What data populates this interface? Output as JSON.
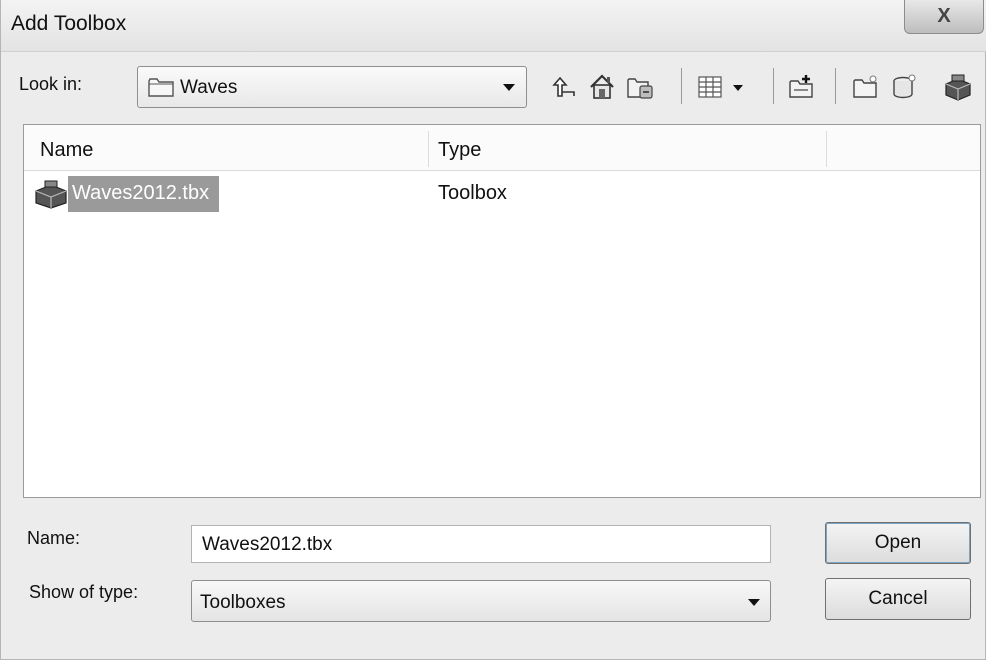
{
  "window": {
    "title": "Add Toolbox",
    "close_glyph": "X"
  },
  "lookin": {
    "label": "Look in:",
    "value": "Waves",
    "icon": "folder-icon"
  },
  "toolbar": {
    "icons": [
      "up-one-level-icon",
      "home-icon",
      "connect-folder-icon",
      "view-menu-icon",
      "new-folder-icon",
      "new-file-geodatabase-icon",
      "new-personal-geodatabase-icon",
      "new-toolbox-icon"
    ]
  },
  "filelist": {
    "columns": [
      "Name",
      "Type"
    ],
    "rows": [
      {
        "name": "Waves2012.tbx",
        "type": "Toolbox",
        "icon": "toolbox-icon",
        "selected": true
      }
    ]
  },
  "form": {
    "name_label": "Name:",
    "name_value": "Waves2012.tbx",
    "type_label": "Show of type:",
    "type_value": "Toolboxes"
  },
  "buttons": {
    "open": "Open",
    "cancel": "Cancel"
  },
  "colors": {
    "selection": "#9a9a9a",
    "background": "#ececec"
  }
}
